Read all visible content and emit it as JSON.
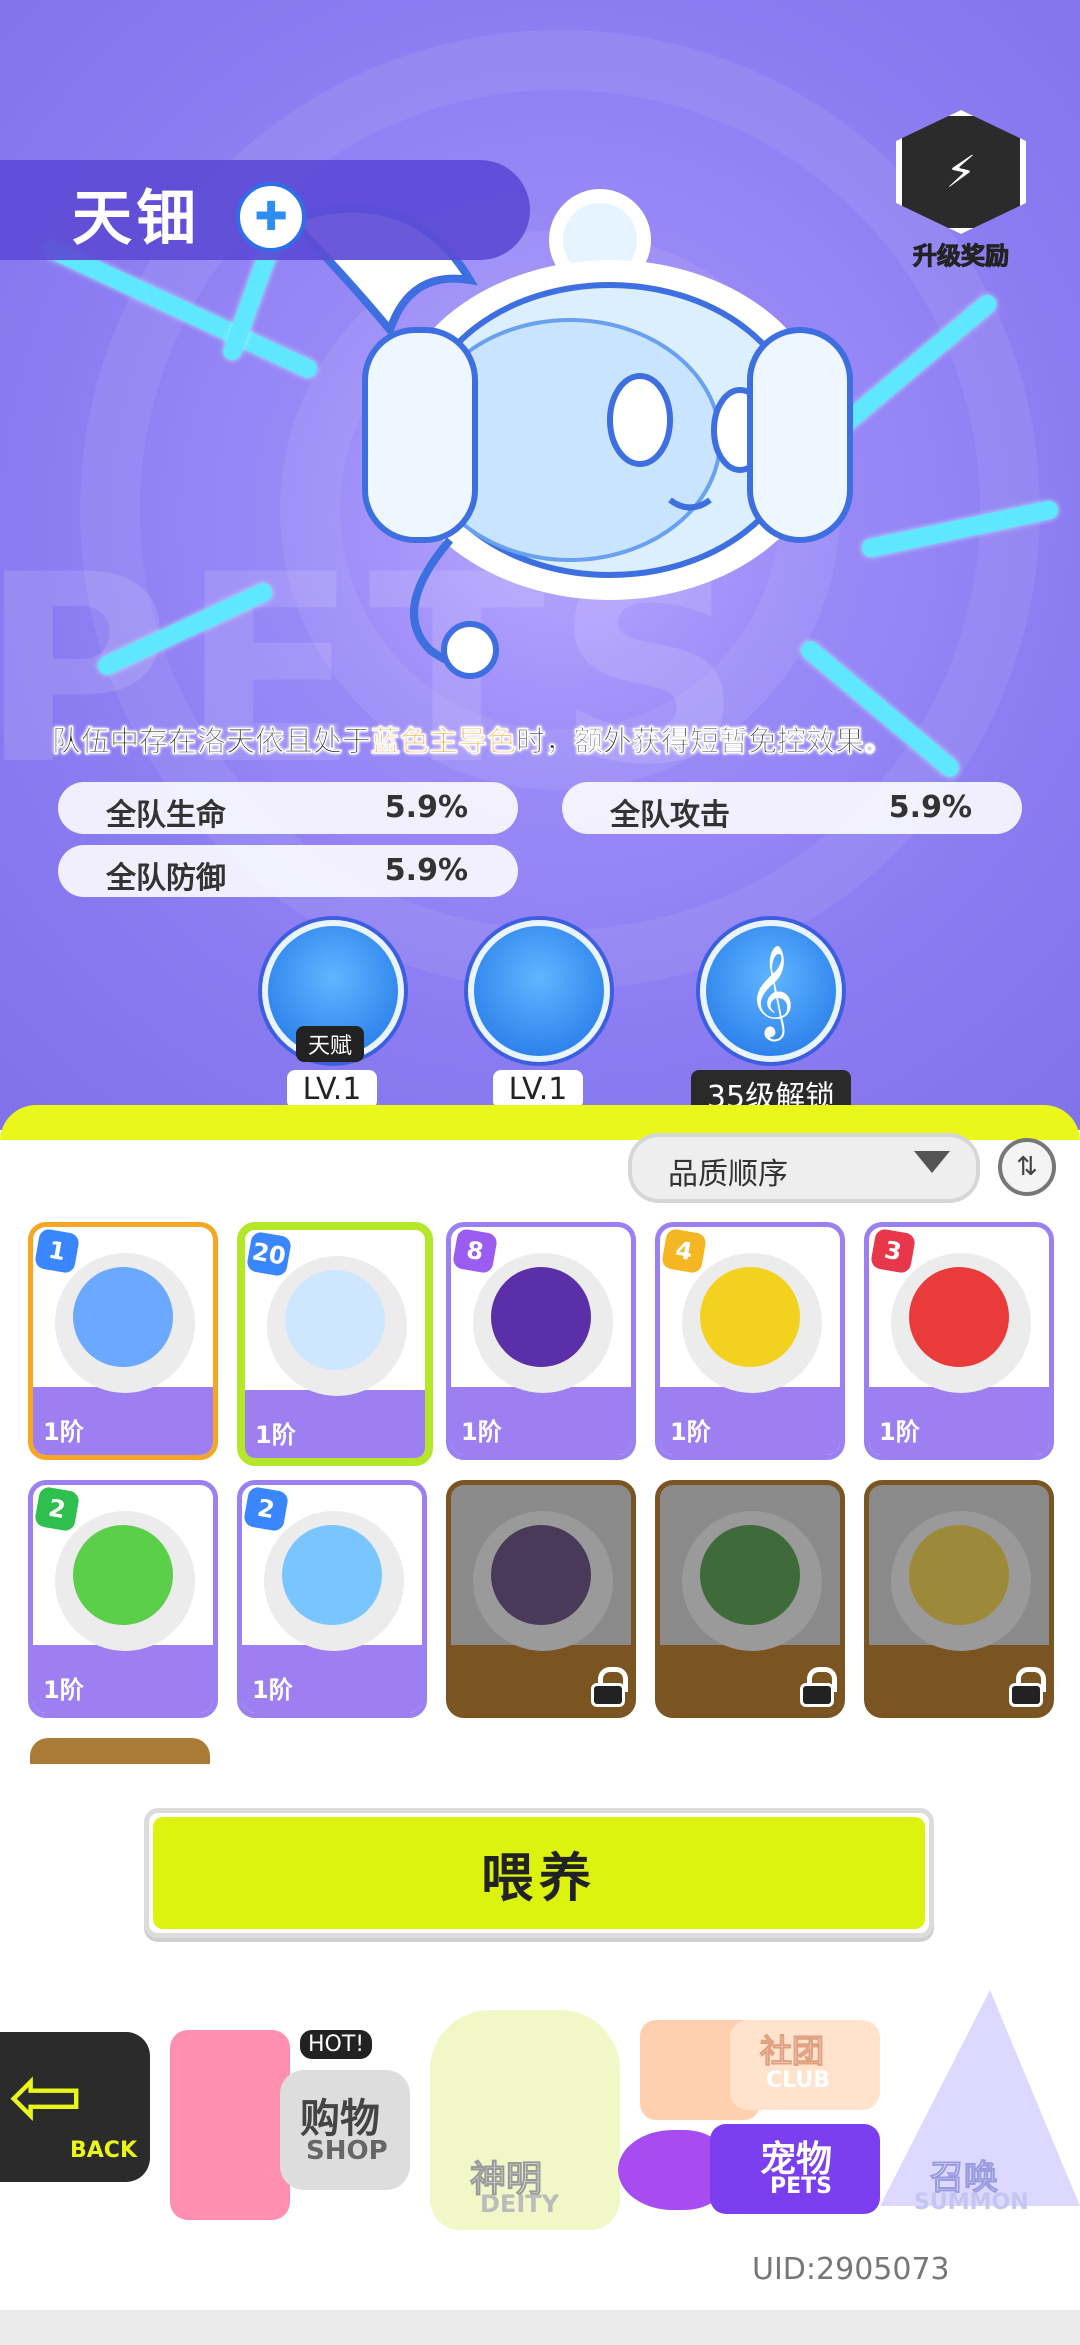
{
  "hero": {
    "pet_name": "天钿",
    "element_icon": "blue-cross-element-icon",
    "upgrade_reward_label": "升级奖励",
    "background_word": "PETS",
    "description_prefix": "队伍中存在洛天依且处于",
    "description_highlight": "蓝色主导色",
    "description_suffix": "时，额外获得短暂免控效果。"
  },
  "stats": [
    {
      "label": "全队生命",
      "value": "5.9%"
    },
    {
      "label": "全队攻击",
      "value": "5.9%"
    },
    {
      "label": "全队防御",
      "value": "5.9%"
    }
  ],
  "skills": [
    {
      "tag": "天赋",
      "level": "LV.1",
      "icon": "music-skill-icon"
    },
    {
      "tag": "",
      "level": "LV.1",
      "icon": "note-flame-skill-icon"
    },
    {
      "tag": "",
      "level": "35级解锁",
      "icon": "treble-clef-skill-icon"
    }
  ],
  "sort": {
    "label": "品质顺序"
  },
  "pets": [
    {
      "level": "1",
      "tier": "1阶",
      "badge_color": "#3a86ff",
      "color": "#6aa9ff",
      "frame": "#f5a623",
      "locked": false
    },
    {
      "level": "20",
      "tier": "1阶",
      "badge_color": "#3a86ff",
      "color": "#cfe6ff",
      "frame": "#b4e62a",
      "locked": false
    },
    {
      "level": "8",
      "tier": "1阶",
      "badge_color": "#9b5cf0",
      "color": "#5a2fa8",
      "frame": "#9a80f0",
      "locked": false
    },
    {
      "level": "4",
      "tier": "1阶",
      "badge_color": "#f5b623",
      "color": "#f2d21f",
      "frame": "#9a80f0",
      "locked": false
    },
    {
      "level": "3",
      "tier": "1阶",
      "badge_color": "#e8364a",
      "color": "#ea3b3b",
      "frame": "#9a80f0",
      "locked": false
    },
    {
      "level": "2",
      "tier": "1阶",
      "badge_color": "#2fbf4f",
      "color": "#5ccf4a",
      "frame": "#9a80f0",
      "locked": false
    },
    {
      "level": "2",
      "tier": "1阶",
      "badge_color": "#3a86ff",
      "color": "#79c5ff",
      "frame": "#9a80f0",
      "locked": false
    },
    {
      "level": "",
      "tier": "",
      "badge_color": "",
      "color": "#4a3a5a",
      "frame": "#7a5522",
      "locked": true
    },
    {
      "level": "",
      "tier": "",
      "badge_color": "",
      "color": "#3f6a3a",
      "frame": "#7a5522",
      "locked": true
    },
    {
      "level": "",
      "tier": "",
      "badge_color": "",
      "color": "#9c8a3a",
      "frame": "#7a5522",
      "locked": true
    }
  ],
  "feed_button": "喂养",
  "nav": {
    "back": "BACK",
    "shop_cn": "购物",
    "shop_en": "SHOP",
    "shop_hot": "HOT!",
    "deity_cn": "神明",
    "deity_en": "DEITY",
    "club_cn": "社团",
    "club_en": "CLUB",
    "pets_cn": "宠物",
    "pets_en": "PETS",
    "summon_cn": "召唤",
    "summon_en": "SUMMON"
  },
  "uid": "UID:2905073",
  "colors": {
    "accent": "#dcf20f",
    "highlight": "#ff9f1a",
    "hero_bg": "#8c7cf2"
  }
}
